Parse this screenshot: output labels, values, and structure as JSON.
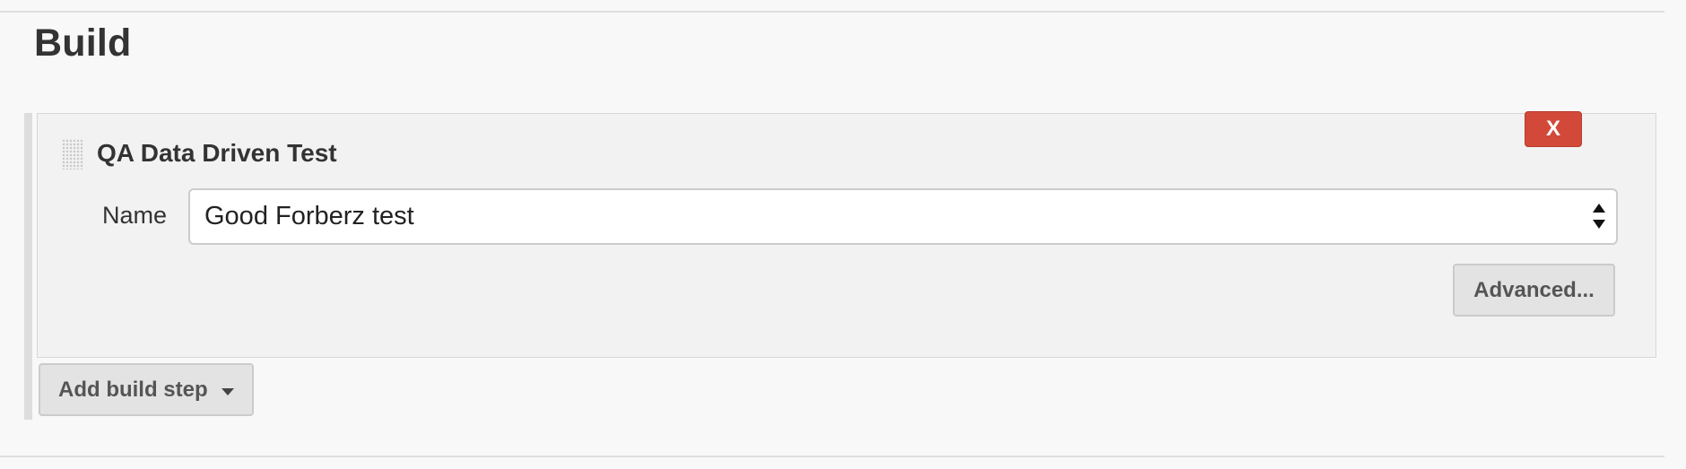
{
  "section": {
    "title": "Build"
  },
  "build_step": {
    "title": "QA Data Driven Test",
    "close_label": "X",
    "name_label": "Name",
    "name_value": "Good Forberz test",
    "advanced_label": "Advanced..."
  },
  "actions": {
    "add_build_step_label": "Add build step"
  },
  "icons": {
    "drag_handle": "drag-handle-icon",
    "select_arrows": "up-down-arrows-icon",
    "dropdown_caret": "chevron-down-icon"
  },
  "colors": {
    "page_background": "#f8f8f8",
    "panel_background": "#f2f2f2",
    "close_button": "#d24939",
    "button_background": "#e3e3e3",
    "divider": "#dedede"
  }
}
